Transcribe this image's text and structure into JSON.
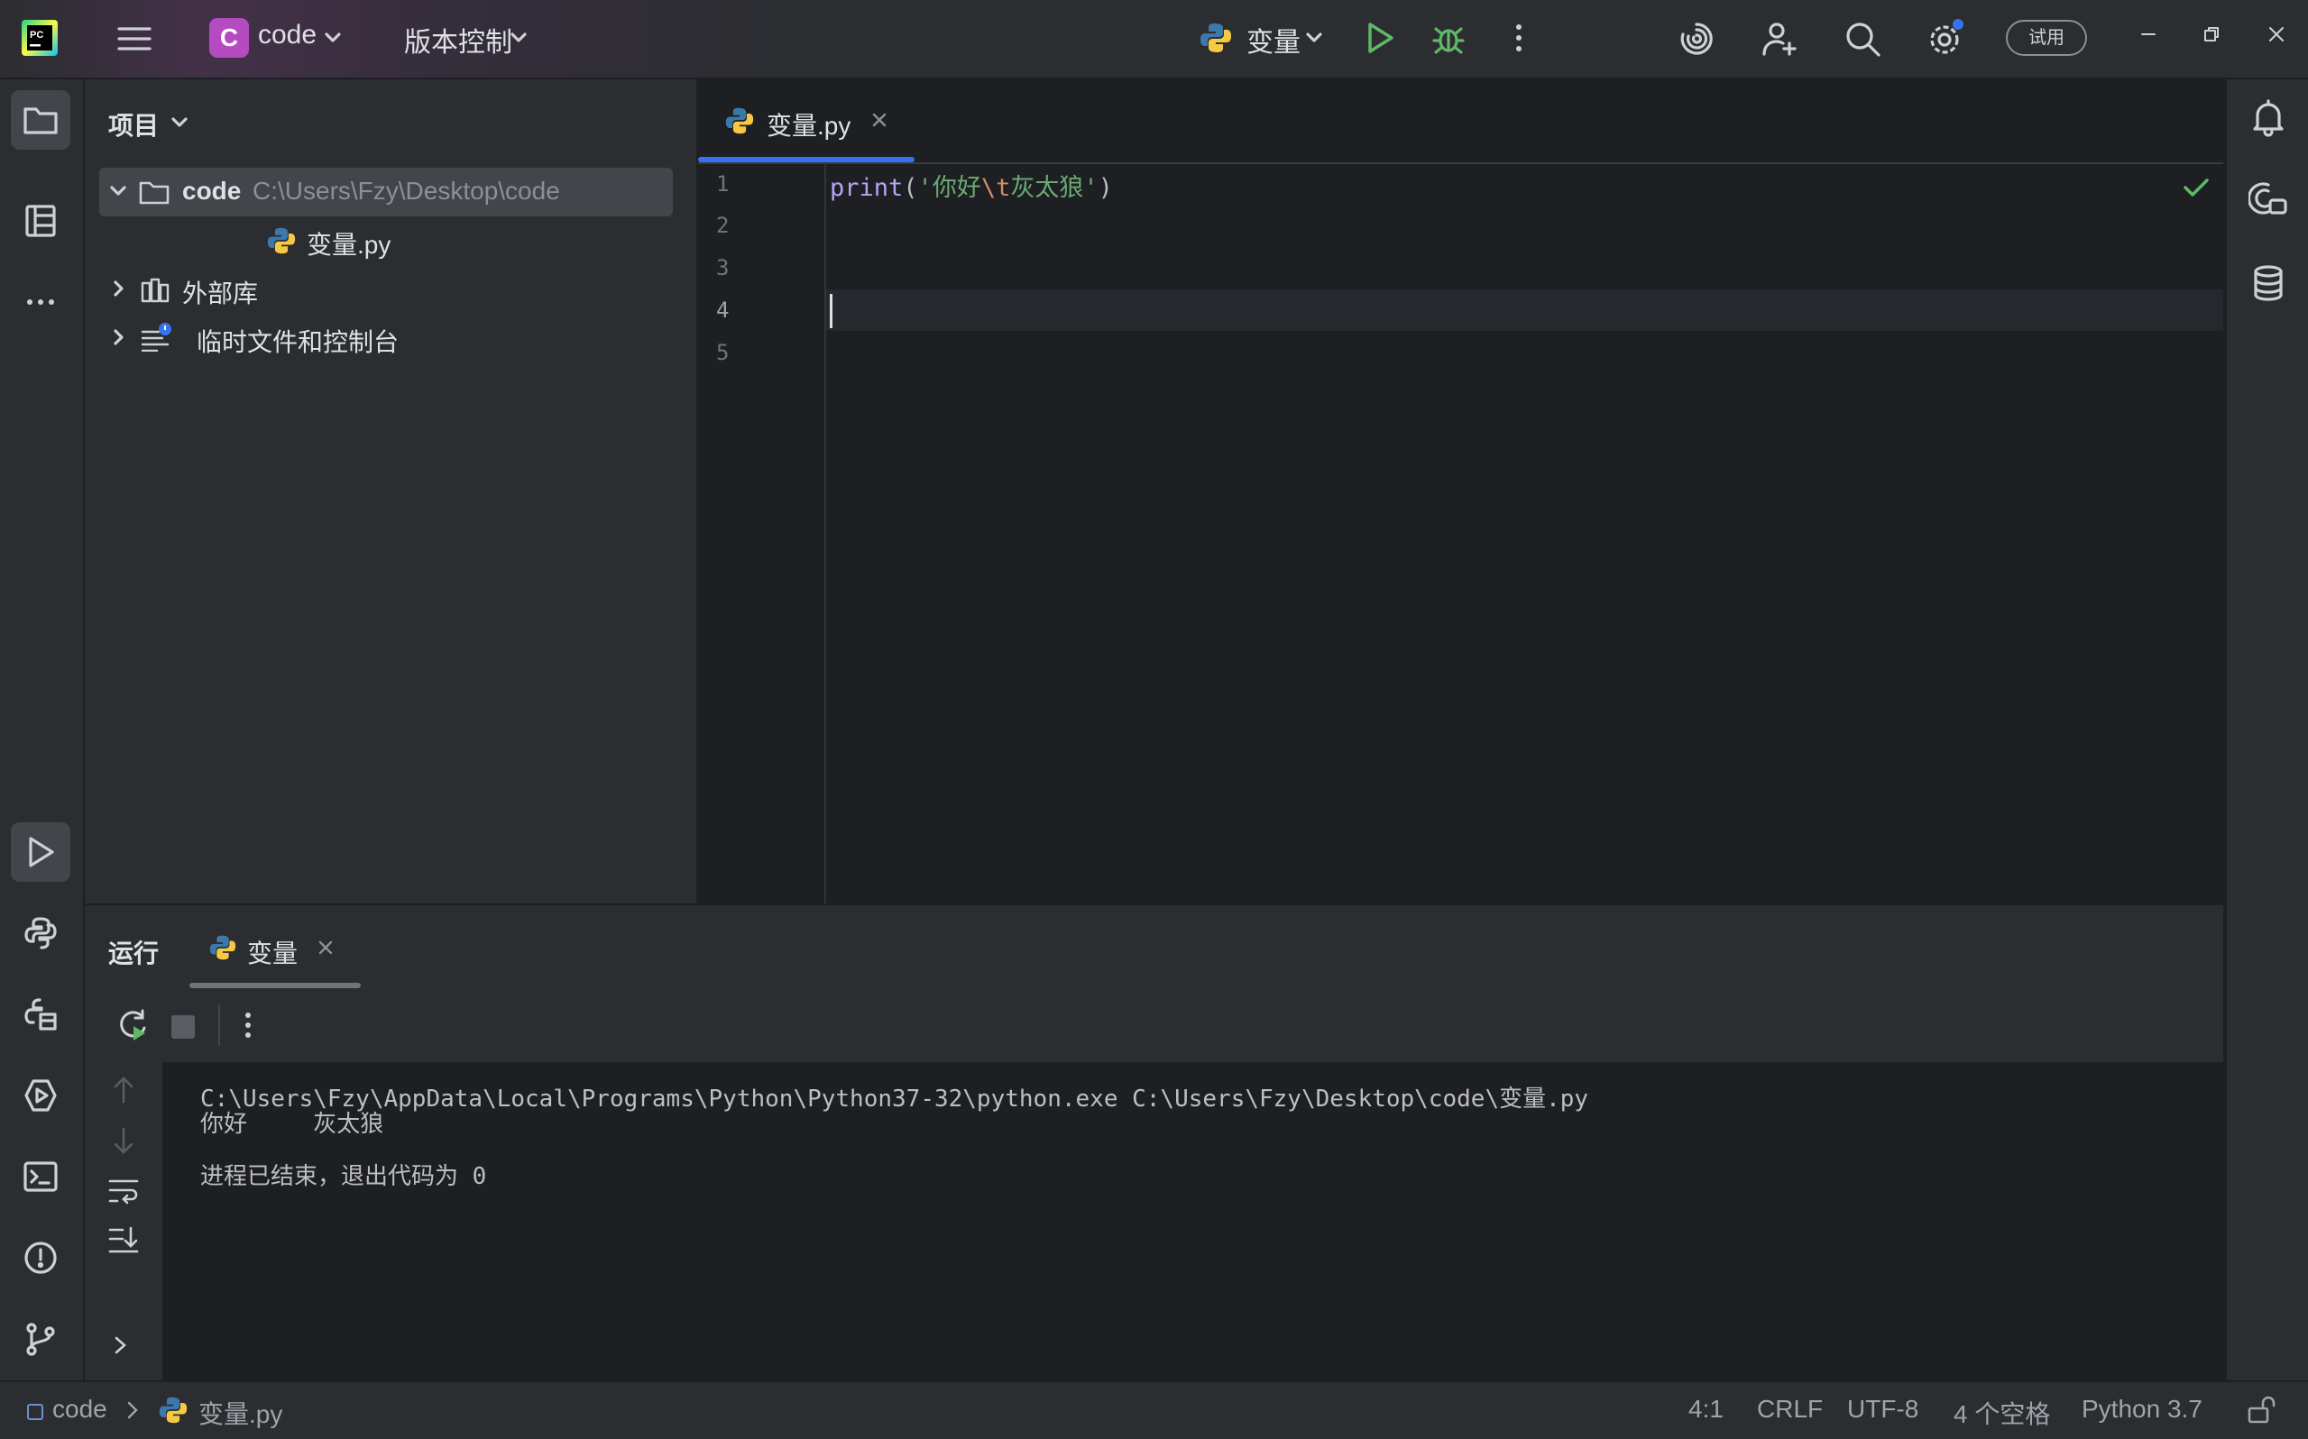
{
  "titlebar": {
    "project_initial": "C",
    "project_name": "code",
    "vcs_menu": "版本控制",
    "run_config": "变量",
    "trial_label": "试用"
  },
  "project_panel": {
    "title": "项目",
    "tree": [
      {
        "label": "code",
        "path": "C:\\Users\\Fzy\\Desktop\\code"
      },
      {
        "label": "变量.py"
      },
      {
        "label": "外部库"
      },
      {
        "label": "临时文件和控制台"
      }
    ]
  },
  "editor": {
    "tab_label": "变量.py",
    "line_numbers": [
      "1",
      "2",
      "3",
      "4",
      "5"
    ],
    "code": {
      "fn": "print",
      "open": "(",
      "quote_open": "'",
      "str_a": "你好",
      "escape": "\\t",
      "str_b": "灰太狼",
      "quote_close": "'",
      "close": ")"
    }
  },
  "run_panel": {
    "title": "运行",
    "tab_label": "变量",
    "console_lines": [
      "C:\\Users\\Fzy\\AppData\\Local\\Programs\\Python\\Python37-32\\python.exe C:\\Users\\Fzy\\Desktop\\code\\变量.py",
      "你好\t灰太狼",
      "",
      "进程已结束，退出代码为 0"
    ]
  },
  "statusbar": {
    "crumb_project": "code",
    "crumb_file": "变量.py",
    "position": "4:1",
    "line_sep": "CRLF",
    "encoding": "UTF-8",
    "indent": "4 个空格",
    "interpreter": "Python 3.7"
  },
  "colors": {
    "accent": "#3574f0",
    "run_green": "#5fb865",
    "project_badge": "#b54bc0",
    "string": "#6aab73",
    "function": "#b3a6f2",
    "escape": "#cf8e6d"
  }
}
